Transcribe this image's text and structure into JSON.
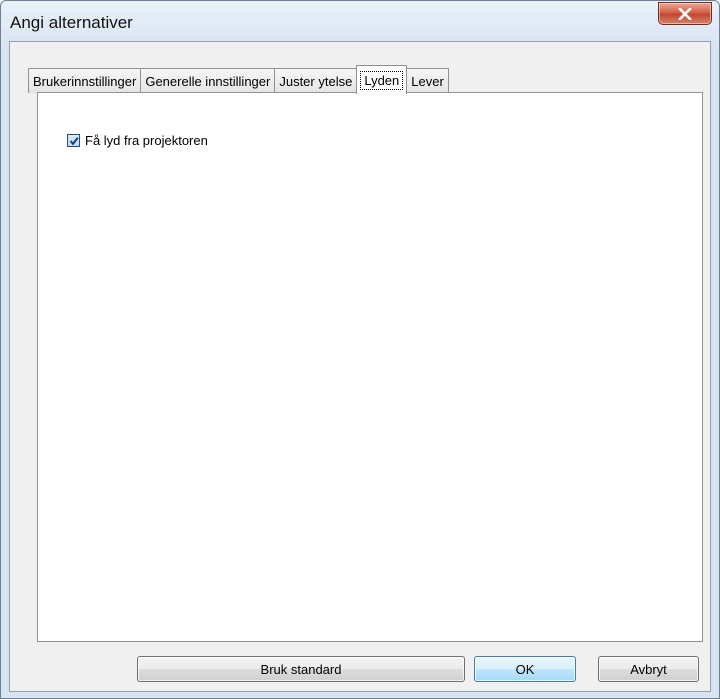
{
  "window": {
    "title": "Angi alternativer"
  },
  "tabs": [
    {
      "label": "Brukerinnstillinger",
      "active": false
    },
    {
      "label": "Generelle innstillinger",
      "active": false
    },
    {
      "label": "Juster ytelse",
      "active": false
    },
    {
      "label": "Lyden",
      "active": true
    },
    {
      "label": "Lever",
      "active": false
    }
  ],
  "sound": {
    "checkbox_label": "Få lyd fra projektoren",
    "checked": true
  },
  "buttons": {
    "defaults_label": "Bruk standard",
    "ok_label": "OK",
    "cancel_label": "Avbryt"
  },
  "icons": {
    "close": "close-icon",
    "check": "checkmark-icon"
  },
  "colors": {
    "close_button": "#c0452c",
    "default_button_border": "#3c7fb1"
  }
}
